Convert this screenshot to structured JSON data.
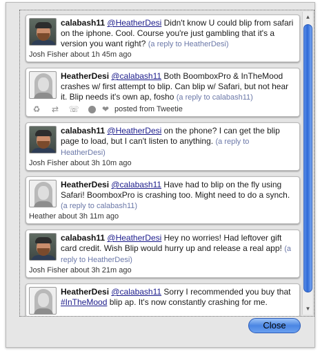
{
  "dialog": {
    "close_label": "Close"
  },
  "actions": {
    "icons": [
      "recycle-icon",
      "retweet-icon",
      "phone-icon",
      "circle-icon",
      "heart-icon"
    ],
    "retweet_glyph": "♻",
    "arrows_glyph": "⇄",
    "phone_glyph": "☏",
    "heart_glyph": "❤"
  },
  "tweets": [
    {
      "author": "calabash11",
      "avatar": "josh",
      "mention": "@HeatherDesi",
      "text": " Didn't know U could blip from safari on the iphone. Cool. Course you're just gambling that it's a version you want right?",
      "reply": "(a reply to HeatherDesi)",
      "meta": "Josh Fisher about 1h 45m ago"
    },
    {
      "author": "HeatherDesi",
      "avatar": "heather",
      "mention": "@calabash11",
      "text": " Both BoomboxPro & InTheMood crashes w/ first attempt to blip. Can blip w/ Safari, but not hear it. Blip needs it's own ap, fosho",
      "reply": "(a reply to calabash11)",
      "posted": "posted from Tweetie"
    },
    {
      "author": "calabash11",
      "avatar": "josh",
      "mention": "@HeatherDesi",
      "text": " on the phone? I can get the blip page to load, but I can't listen to anything.",
      "reply": "(a reply to HeatherDesi)",
      "meta": "Josh Fisher about 3h 10m ago"
    },
    {
      "author": "HeatherDesi",
      "avatar": "heather",
      "mention": "@calabash11",
      "text": " Have had to blip on the fly using Safari! BoomboxPro is crashing too. Might need to do a synch.",
      "reply": "(a reply to calabash11)",
      "meta": "Heather about 3h 11m ago"
    },
    {
      "author": "calabash11",
      "avatar": "josh",
      "mention": "@HeatherDesi",
      "text": " Hey no worries! Had leftover gift card credit. Wish Blip would hurry up and release a real app!",
      "reply": "(a reply to HeatherDesi)",
      "meta": "Josh Fisher about 3h 21m ago"
    },
    {
      "author": "HeatherDesi",
      "avatar": "heather",
      "mention": "@calabash11",
      "text_a": " Sorry I recommended you buy that ",
      "hashtag": "#InTheMood",
      "text_b": " blip ap. It's now constantly crashing for me."
    }
  ]
}
